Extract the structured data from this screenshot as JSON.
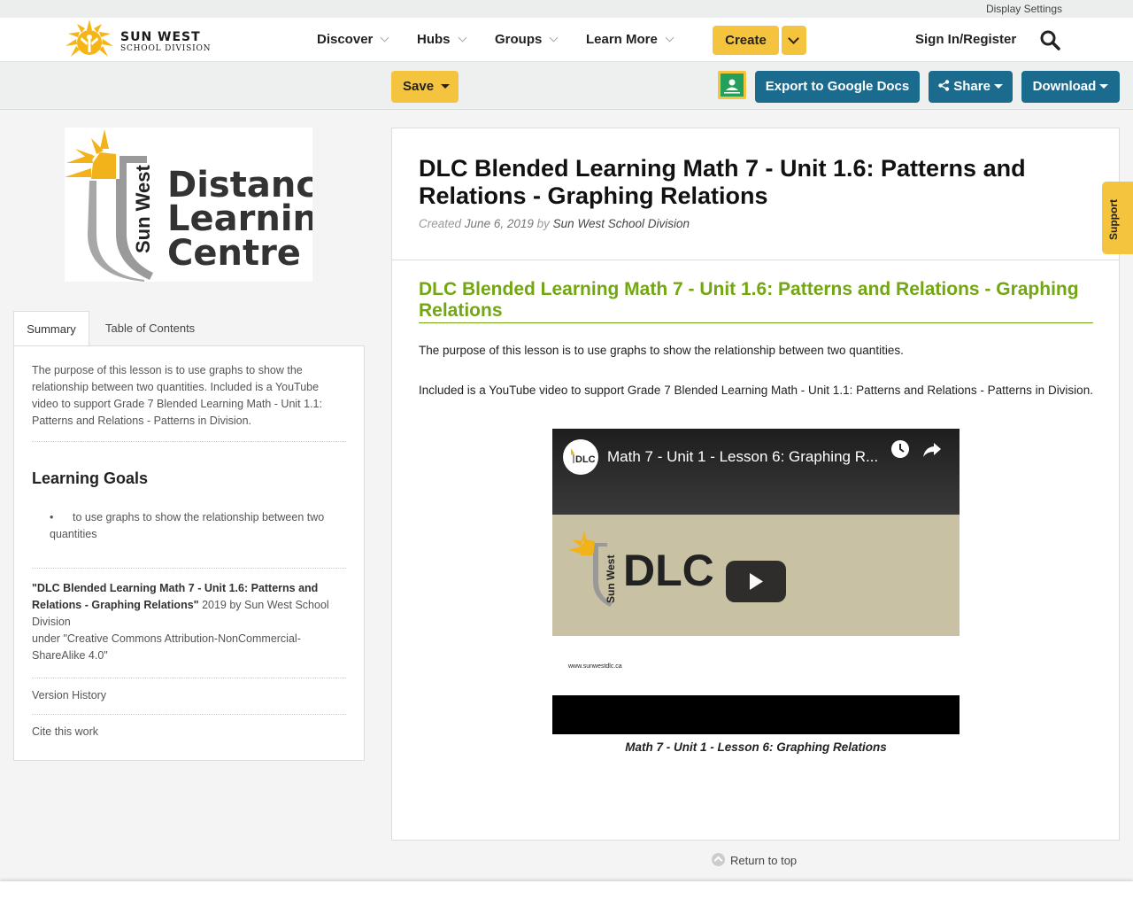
{
  "topbar": {
    "display_settings": "Display Settings"
  },
  "header": {
    "logo_line1": "SUN WEST",
    "logo_line2": "SCHOOL DIVISION",
    "nav": [
      "Discover",
      "Hubs",
      "Groups",
      "Learn More"
    ],
    "create_label": "Create",
    "signin_label": "Sign In/Register"
  },
  "toolbar": {
    "save_label": "Save",
    "export_label": "Export to Google Docs",
    "share_label": "Share",
    "download_label": "Download"
  },
  "sidebar": {
    "logo_text": {
      "brand": "Sun West",
      "line1": "Distance",
      "line2": "Learning",
      "line3": "Centre"
    },
    "tabs": [
      "Summary",
      "Table of Contents"
    ],
    "summary": "The purpose of this lesson is to use graphs to show the relationship between two quantities. Included is a YouTube video to support Grade 7 Blended Learning Math - Unit 1.1: Patterns and Relations - Patterns in Division.",
    "goals_heading": "Learning Goals",
    "goals": [
      "to use graphs to show the relationship between two quantities"
    ],
    "license_title": "\"DLC Blended Learning Math 7 - Unit 1.6: Patterns and Relations - Graphing Relations\"",
    "license_rest": " 2019 by Sun West School Division",
    "license_under": "under \"Creative Commons Attribution-NonCommercial-ShareAlike 4.0\"",
    "version_history": "Version History",
    "cite": "Cite this work"
  },
  "main": {
    "title": "DLC Blended Learning Math 7 - Unit 1.6: Patterns and Relations - Graphing Relations",
    "created_label": "Created",
    "created_date": "June 6, 2019",
    "by_label": "by",
    "author": "Sun West School Division",
    "heading": "DLC Blended Learning Math 7 - Unit 1.6: Patterns and Relations - Graphing Relations",
    "para1": "The purpose of this lesson is to use graphs to show the relationship between two quantities.",
    "para2": "Included is a YouTube video to support Grade 7 Blended Learning Math - Unit 1.1: Patterns and Relations - Patterns in Division.",
    "video": {
      "title": "Math 7 - Unit 1 - Lesson 6: Graphing R...",
      "logo_text": "DLC",
      "brand": "Sun West",
      "url": "www.sunwestdlc.ca",
      "caption": "Math 7 - Unit 1 - Lesson 6: Graphing Relations"
    },
    "return_top": "Return to top"
  },
  "support_label": "Support",
  "colors": {
    "accent_yellow": "#f5c43e",
    "button_blue": "#1a6b8e",
    "heading_green": "#72a613"
  }
}
